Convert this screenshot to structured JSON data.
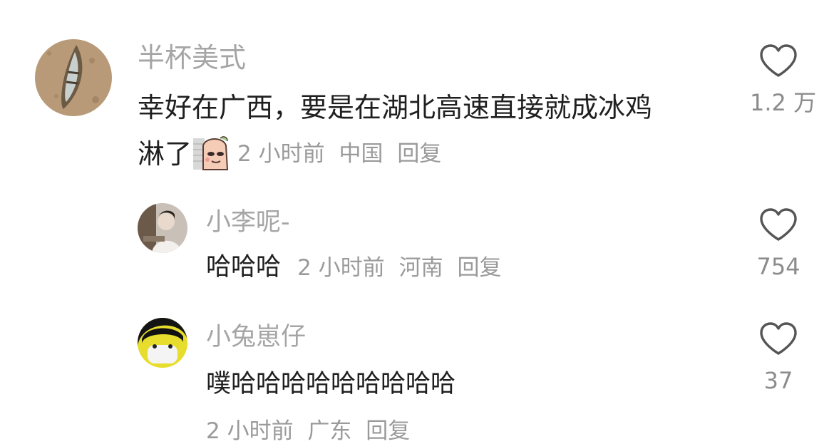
{
  "comments": [
    {
      "username": "半杯美式",
      "text_line1": "幸好在广西，要是在湖北高速直接就成冰鸡",
      "text_line2": "淋了",
      "sticker_icon": "face-sticker-icon",
      "time": "2 小时前",
      "location": "中国",
      "reply_label": "回复",
      "likes": "1.2 万",
      "avatar_icon": "boat-avatar"
    }
  ],
  "replies": [
    {
      "username": "小李呢-",
      "text": "哈哈哈",
      "time": "2 小时前",
      "location": "河南",
      "reply_label": "回复",
      "likes": "754",
      "avatar_icon": "person-avatar"
    },
    {
      "username": "小兔崽仔",
      "text": "噗哈哈哈哈哈哈哈哈哈",
      "time": "2 小时前",
      "location": "广东",
      "reply_label": "回复",
      "likes": "37",
      "avatar_icon": "masked-person-avatar"
    }
  ],
  "colors": {
    "username": "#a5a5a5",
    "text": "#1f1f1f",
    "meta": "#9a9a9a",
    "heart_stroke": "#555555"
  }
}
